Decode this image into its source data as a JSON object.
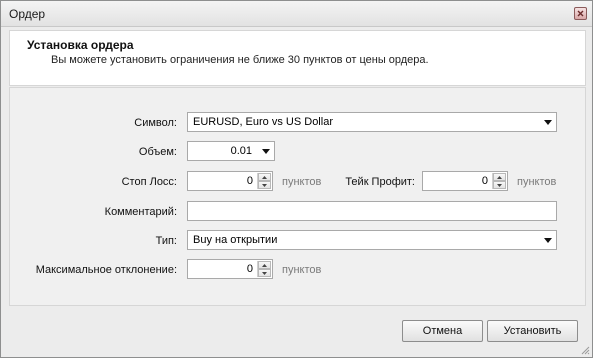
{
  "window": {
    "title": "Ордер"
  },
  "header": {
    "title": "Установка ордера",
    "subtitle": "Вы можете установить ограничения не ближе 30 пунктов от цены ордера."
  },
  "form": {
    "symbol": {
      "label": "Символ:",
      "value": "EURUSD, Euro vs US Dollar"
    },
    "volume": {
      "label": "Объем:",
      "value": "0.01"
    },
    "stop_loss": {
      "label": "Стоп Лосс:",
      "value": "0",
      "unit": "пунктов"
    },
    "take_profit": {
      "label": "Тейк Профит:",
      "value": "0",
      "unit": "пунктов"
    },
    "comment": {
      "label": "Комментарий:",
      "value": ""
    },
    "type": {
      "label": "Тип:",
      "value": "Buy на открытии"
    },
    "max_deviation": {
      "label": "Максимальное отклонение:",
      "value": "0",
      "unit": "пунктов"
    }
  },
  "buttons": {
    "cancel": "Отмена",
    "submit": "Установить"
  },
  "icons": {
    "close": "close-icon",
    "dropdown": "chevron-down-icon",
    "spin_up": "arrow-up-icon",
    "spin_down": "arrow-down-icon",
    "resize": "resize-grip-icon"
  }
}
